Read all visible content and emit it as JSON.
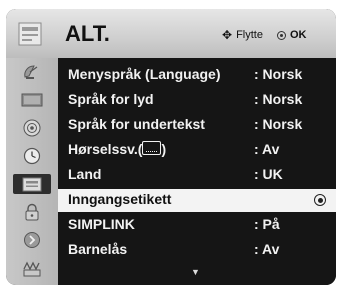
{
  "header": {
    "title": "ALT.",
    "hint_move": "Flytte",
    "hint_ok": "OK",
    "icon": "settings-options-icon"
  },
  "sidebar": {
    "items": [
      {
        "icon": "satellite-dish-icon"
      },
      {
        "icon": "picture-icon"
      },
      {
        "icon": "speaker-audio-icon"
      },
      {
        "icon": "clock-time-icon"
      },
      {
        "icon": "option-toolbox-icon",
        "selected": true
      },
      {
        "icon": "lock-icon"
      },
      {
        "icon": "input-plug-icon"
      },
      {
        "icon": "usb-media-icon"
      }
    ]
  },
  "menu": {
    "rows": [
      {
        "label": "Menyspråk (Language)",
        "value": ": Norsk"
      },
      {
        "label": "Språk for lyd",
        "value": ": Norsk"
      },
      {
        "label": "Språk for undertekst",
        "value": ": Norsk"
      },
      {
        "label": "Hørselssv.(",
        "label_suffix": ")",
        "value": ": Av"
      },
      {
        "label": "Land",
        "value": ": UK"
      },
      {
        "label": "Inngangsetikett",
        "value": "",
        "selected": true
      },
      {
        "label": "SIMPLINK",
        "value": ": På"
      },
      {
        "label": "Barnelås",
        "value": ": Av"
      }
    ],
    "scroll_indicator": "▼"
  },
  "colors": {
    "panel_bg": "#151515",
    "header_bg": "#d4d4d4",
    "sidebar_bg": "#bdbdbd",
    "selected_row_bg": "#f3f3f3",
    "text": "#f2f2f2"
  }
}
